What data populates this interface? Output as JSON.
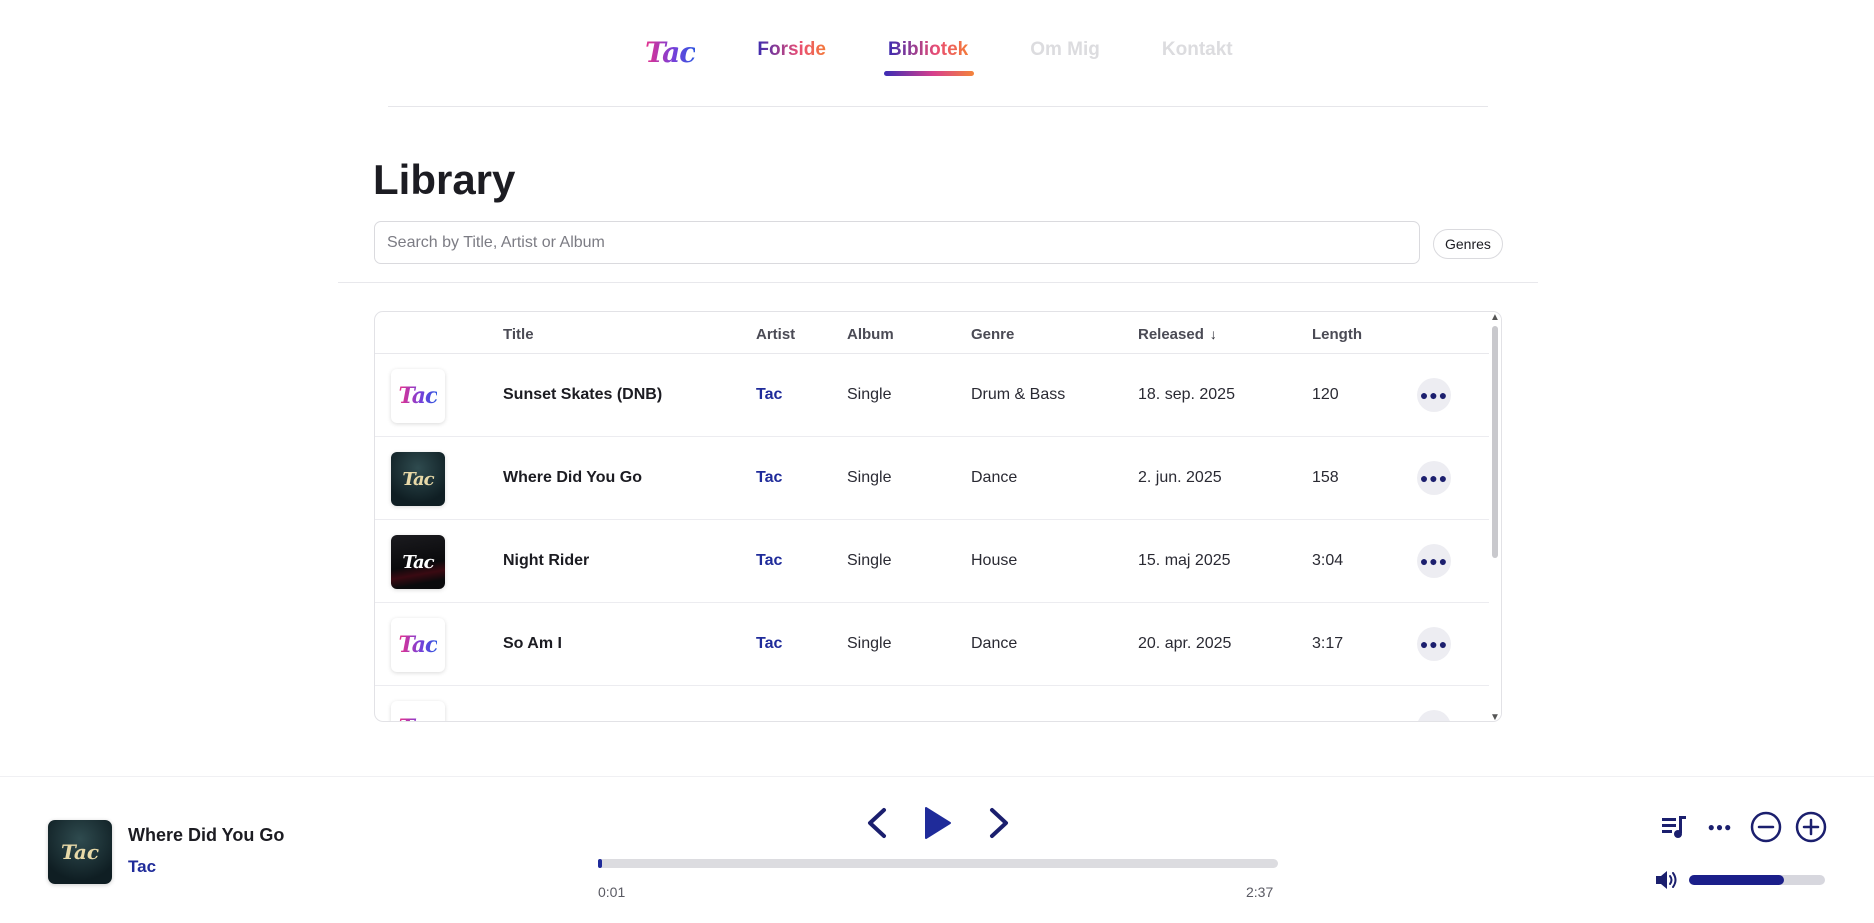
{
  "nav": {
    "logo": "Tac",
    "links": [
      {
        "label": "Forside"
      },
      {
        "label": "Bibliotek"
      },
      {
        "label": "Om Mig"
      },
      {
        "label": "Kontakt"
      }
    ],
    "active": "Bibliotek"
  },
  "library": {
    "title": "Library",
    "search_placeholder": "Search by Title, Artist or Album",
    "genres_label": "Genres",
    "columns": {
      "title": "Title",
      "artist": "Artist",
      "album": "Album",
      "genre": "Genre",
      "released": "Released",
      "length": "Length"
    },
    "sort": {
      "column": "Released",
      "direction": "descending"
    },
    "rows": [
      {
        "cover": "tac-logo",
        "title": "Sunset Skates (DNB)",
        "artist": "Tac",
        "album": "Single",
        "genre": "Drum & Bass",
        "released": "18. sep. 2025",
        "length": "120"
      },
      {
        "cover": "where-did-you-go",
        "title": "Where Did You Go",
        "artist": "Tac",
        "album": "Single",
        "genre": "Dance",
        "released": "2. jun. 2025",
        "length": "158"
      },
      {
        "cover": "night-rider",
        "title": "Night Rider",
        "artist": "Tac",
        "album": "Single",
        "genre": "House",
        "released": "15. maj 2025",
        "length": "3:04"
      },
      {
        "cover": "tac-logo",
        "title": "So Am I",
        "artist": "Tac",
        "album": "Single",
        "genre": "Dance",
        "released": "20. apr. 2025",
        "length": "3:17"
      }
    ]
  },
  "player": {
    "title": "Where Did You Go",
    "artist": "Tac",
    "elapsed": "0:01",
    "duration": "2:37",
    "progress": 0.006,
    "volume": 0.7,
    "accent_color": "#1f2b9a"
  }
}
